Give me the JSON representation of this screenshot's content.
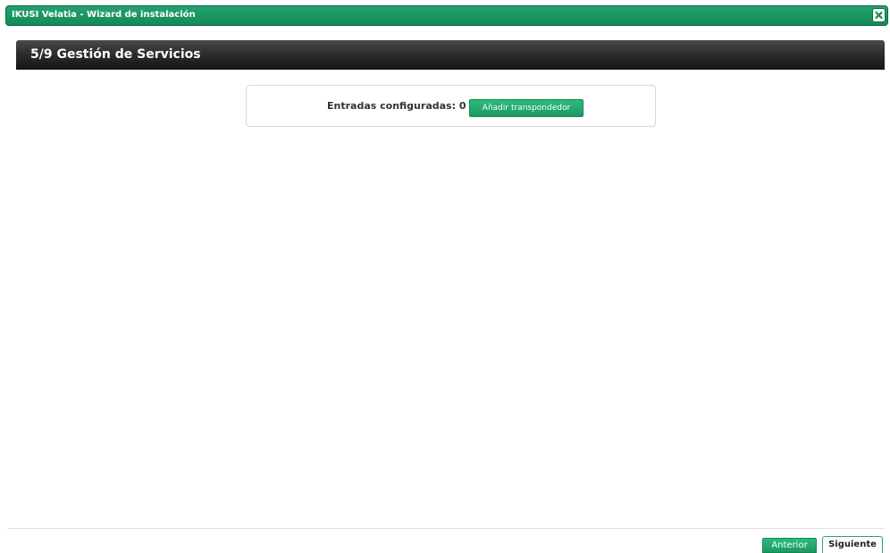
{
  "window": {
    "title": "IKUSI Velatia - Wizard de instalación",
    "close_icon": "close-icon"
  },
  "step": {
    "title": "5/9 Gestión de Servicios"
  },
  "entries": {
    "label": "Entradas configuradas: 0",
    "add_button_label": "Añadir transpondedor"
  },
  "footer": {
    "prev_label": "Anterior",
    "next_label": "Siguiente"
  },
  "colors": {
    "accent": "#1a9a62",
    "header_dark": "#2e2e2e"
  }
}
